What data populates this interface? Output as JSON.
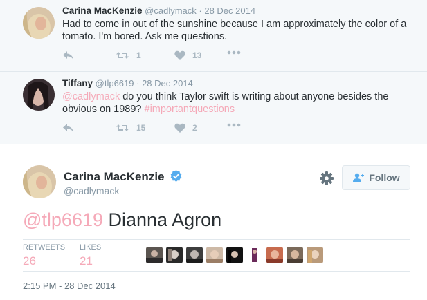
{
  "context_tweets": [
    {
      "fullname": "Carina MacKenzie",
      "screenname": "@cadlymack",
      "date": "· 28 Dec 2014",
      "text": "Had to come in out of the sunshine because I am approximately the color of a tomato. I'm bored. Ask me questions.",
      "retweets": "1",
      "likes": "13"
    },
    {
      "fullname": "Tiffany",
      "screenname": "@tlp6619",
      "date": "· 28 Dec 2014",
      "mention": "@cadlymack",
      "text": " do you think Taylor swift is writing about anyone besides the obvious on 1989? ",
      "hashtag": "#importantquestions",
      "retweets": "15",
      "likes": "2"
    }
  ],
  "main_tweet": {
    "fullname": "Carina MacKenzie",
    "screenname": "@cadlymack",
    "follow_label": "Follow",
    "mention": "@tlp6619",
    "text": " Dianna Agron",
    "retweets_label": "RETWEETS",
    "retweets": "26",
    "likes_label": "LIKES",
    "likes": "21",
    "timestamp": "2:15 PM - 28 Dec 2014"
  },
  "colors": {
    "accent_pink": "#f5a9b8",
    "verified_blue": "#55acee",
    "icon_gray": "#aab8c2"
  }
}
